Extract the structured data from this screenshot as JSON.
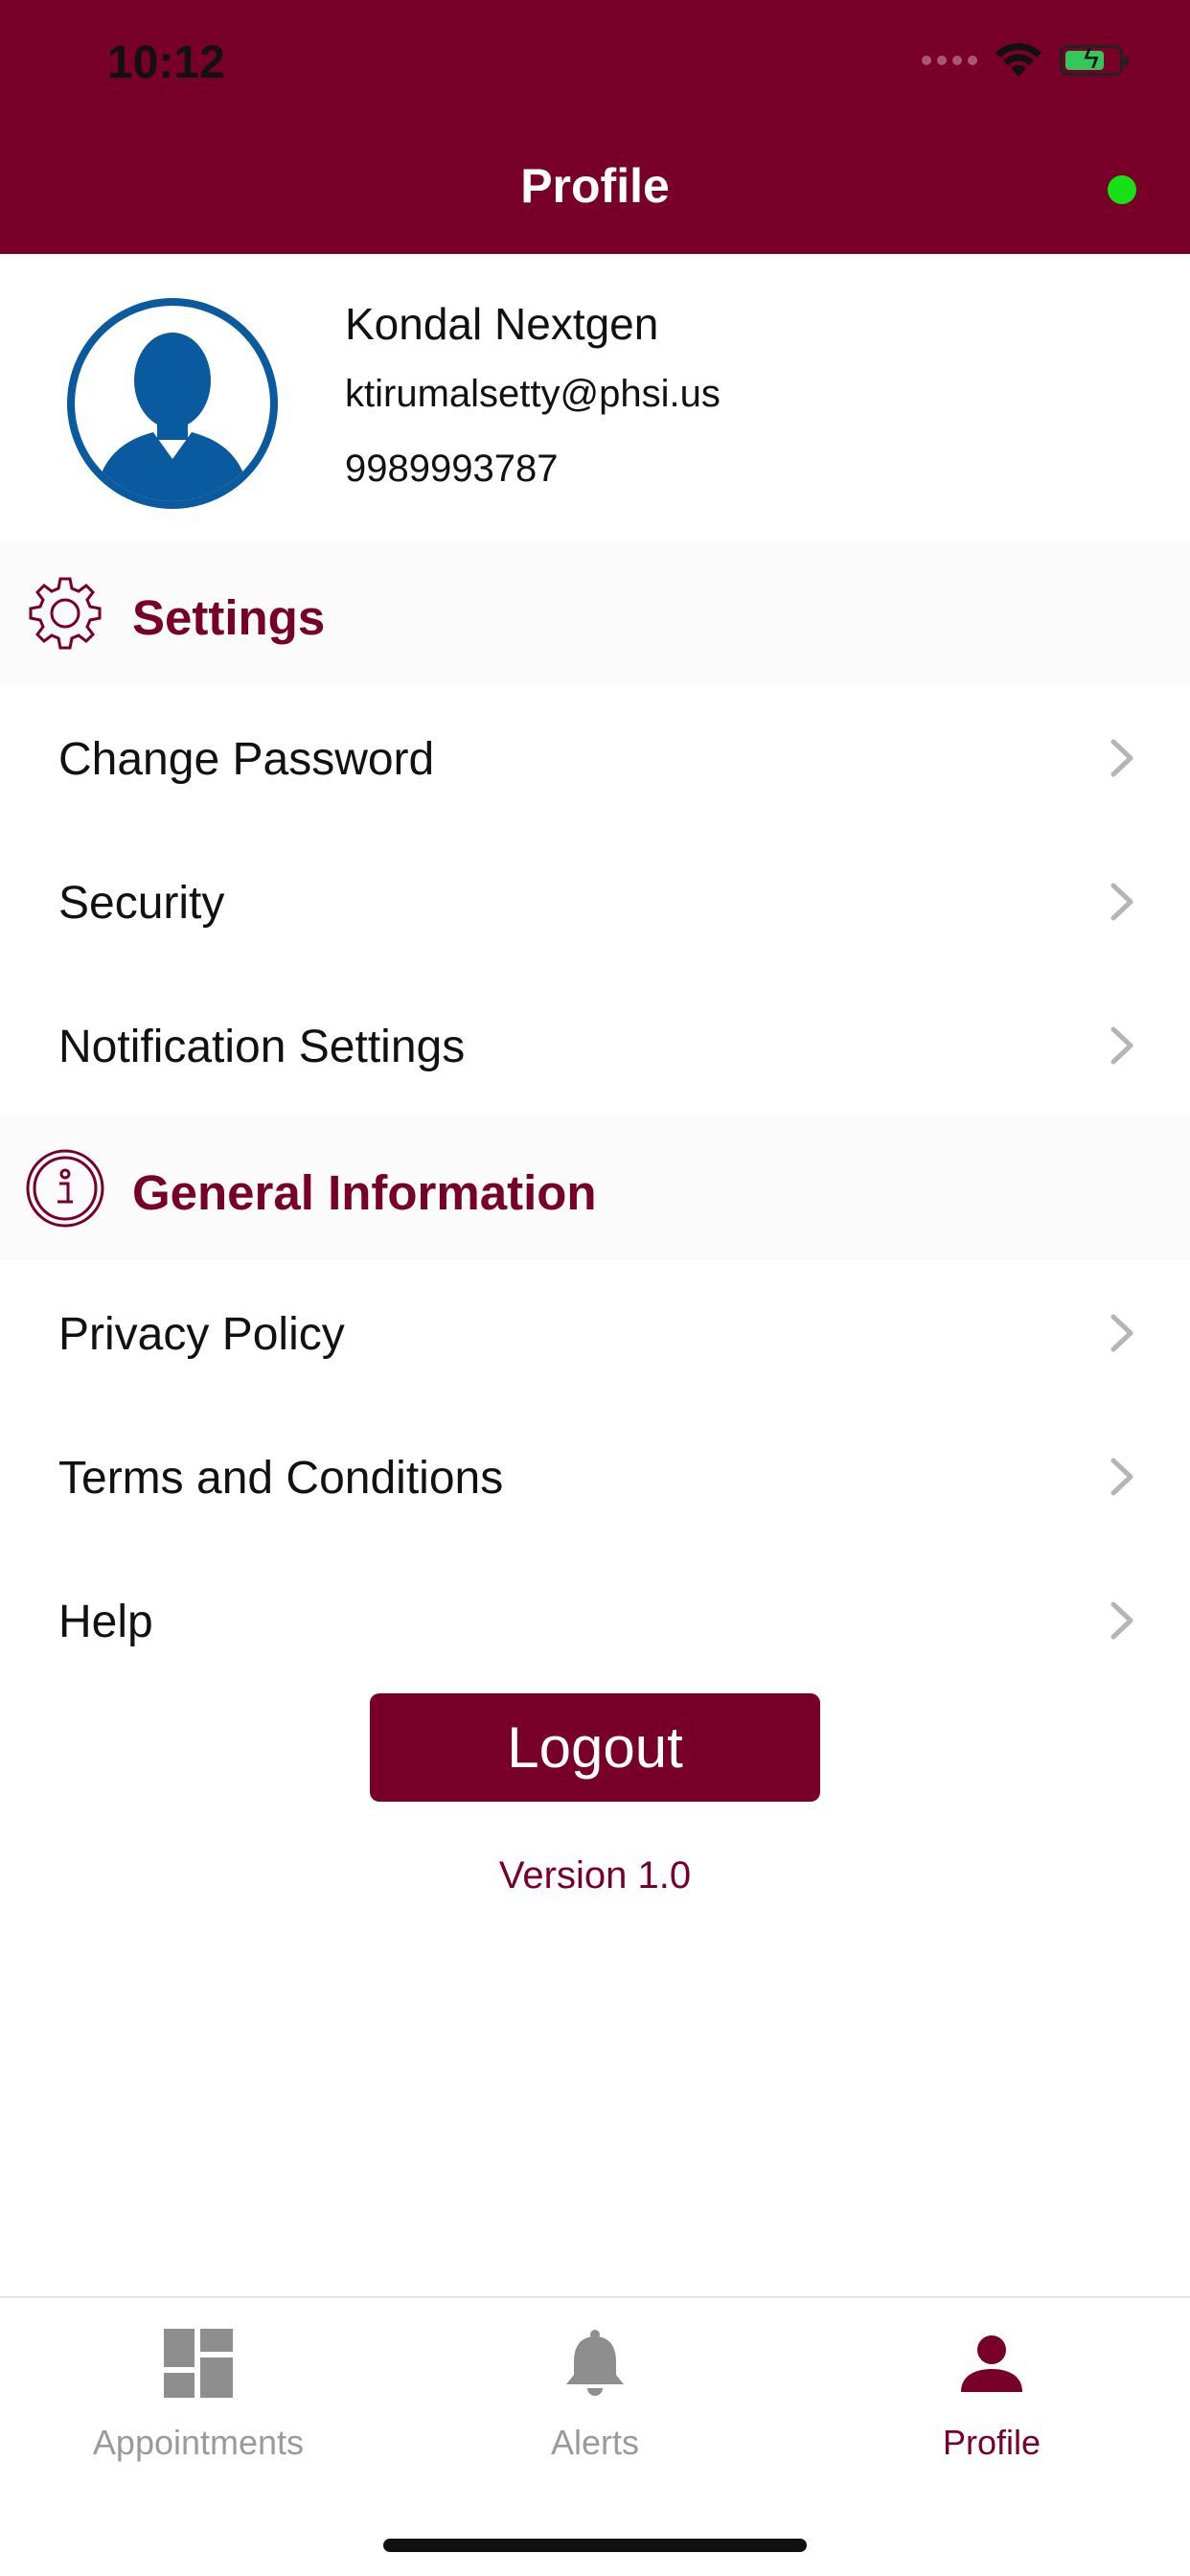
{
  "status_bar": {
    "time": "10:12"
  },
  "header": {
    "title": "Profile"
  },
  "profile": {
    "name": "Kondal Nextgen",
    "email": "ktirumalsetty@phsi.us",
    "phone": "9989993787"
  },
  "sections": {
    "settings": {
      "title": "Settings",
      "icon": "gear-icon",
      "items": [
        {
          "label": "Change Password"
        },
        {
          "label": "Security"
        },
        {
          "label": "Notification Settings"
        }
      ]
    },
    "general": {
      "title": "General Information",
      "icon": "info-icon",
      "items": [
        {
          "label": "Privacy Policy"
        },
        {
          "label": "Terms and Conditions"
        },
        {
          "label": "Help"
        }
      ]
    }
  },
  "logout": {
    "label": "Logout"
  },
  "version": "Version 1.0",
  "tabs": [
    {
      "label": "Appointments",
      "icon": "dashboard-icon",
      "active": false
    },
    {
      "label": "Alerts",
      "icon": "bell-icon",
      "active": false
    },
    {
      "label": "Profile",
      "icon": "person-icon",
      "active": true
    }
  ],
  "colors": {
    "brand": "#780028",
    "online": "#16e016",
    "avatar": "#0a5aa0",
    "inactive_tab": "#9a9a9a"
  }
}
